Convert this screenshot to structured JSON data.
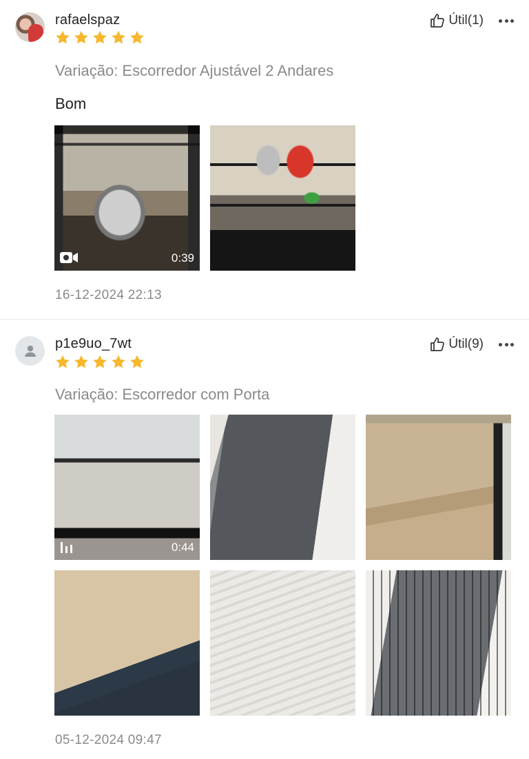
{
  "reviews": [
    {
      "username": "rafaelspaz",
      "avatar_type": "photo",
      "rating": 5,
      "useful_label": "Útil(1)",
      "variation": "Variação: Escorredor Ajustável 2 Andares",
      "comment": "Bom",
      "media": [
        {
          "kind": "video",
          "duration": "0:39",
          "icon": "video-camera-icon"
        },
        {
          "kind": "image"
        }
      ],
      "date": "16-12-2024 22:13"
    },
    {
      "username": "p1e9uo_7wt",
      "avatar_type": "default",
      "rating": 5,
      "useful_label": "Útil(9)",
      "variation": "Variação: Escorredor com Porta",
      "comment": "",
      "media": [
        {
          "kind": "video",
          "duration": "0:44",
          "icon": "video-bars-icon"
        },
        {
          "kind": "image"
        },
        {
          "kind": "image"
        },
        {
          "kind": "image"
        },
        {
          "kind": "image"
        },
        {
          "kind": "image"
        }
      ],
      "date": "05-12-2024 09:47"
    }
  ],
  "colors": {
    "star": "#f5b82e",
    "muted_text": "#8a8a8a",
    "divider": "#e6e6e6"
  },
  "icons": {
    "useful": "thumbs-up-icon",
    "more": "more-dots-icon",
    "default_avatar": "user-silhouette-icon"
  }
}
